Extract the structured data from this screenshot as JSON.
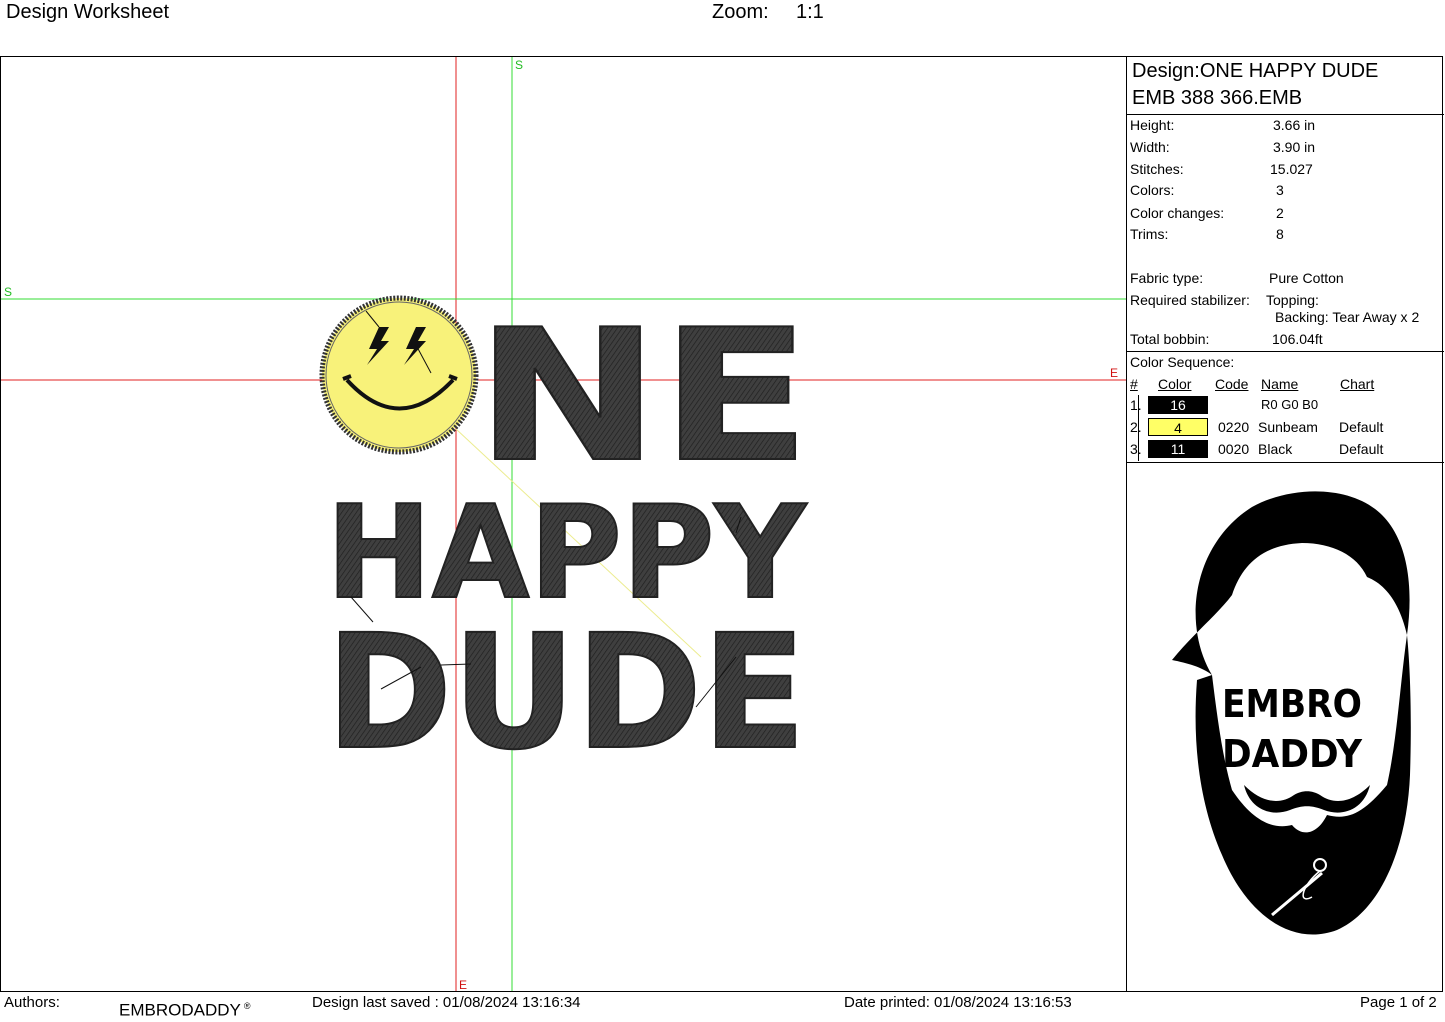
{
  "header": {
    "title": "Design Worksheet",
    "zoom_label": "Zoom:",
    "zoom_value": "1:1"
  },
  "canvas": {
    "marker_s": "S",
    "marker_e": "E",
    "design_text": {
      "line1": "NE",
      "line2": "HAPPY",
      "line3": "DUDE"
    },
    "colors": {
      "stitch_black": "#3f3f3f",
      "sunbeam": "#f8f27a",
      "guide_red": "#e02020",
      "guide_green": "#33dd33"
    }
  },
  "panel": {
    "design_name": "Design:ONE HAPPY DUDE",
    "file_name": "EMB 388 366.EMB",
    "stats": [
      {
        "label": "Height:",
        "value": "3.66 in"
      },
      {
        "label": "Width:",
        "value": "3.90 in"
      },
      {
        "label": "Stitches:",
        "value": "15.027"
      },
      {
        "label": "Colors:",
        "value": "3"
      },
      {
        "label": "Color changes:",
        "value": "2"
      },
      {
        "label": "Trims:",
        "value": "8"
      }
    ],
    "fabric_label": "Fabric type:",
    "fabric_value": "Pure Cotton",
    "stabilizer_label": "Required stabilizer:",
    "topping": "Topping:",
    "backing": "Backing: Tear Away x 2",
    "bobbin_label": "Total bobbin:",
    "bobbin_value": "106.04ft",
    "color_sequence_title": "Color Sequence:",
    "table_headers": {
      "num": "#",
      "color": "Color",
      "code": "Code",
      "name": "Name",
      "chart": "Chart"
    },
    "color_rows": [
      {
        "num": "1.",
        "color_num": "16",
        "swatch": "#000000",
        "text": "#ffffff",
        "code": "",
        "name": "R0 G0 B0",
        "chart": ""
      },
      {
        "num": "2.",
        "color_num": "4",
        "swatch": "#ffff66",
        "text": "#000000",
        "code": "0220",
        "name": "Sunbeam",
        "chart": "Default"
      },
      {
        "num": "3.",
        "color_num": "11",
        "swatch": "#000000",
        "text": "#ffffff",
        "code": "0020",
        "name": "Black",
        "chart": "Default"
      }
    ],
    "logo": {
      "line1": "EMBRO",
      "line2": "DADDY"
    }
  },
  "footer": {
    "authors_label": "Authors:",
    "brand": "EMBRODADDY",
    "brand_mark": "®",
    "saved": "Design last saved : 01/08/2024 13:16:34",
    "printed": "Date printed: 01/08/2024 13:16:53",
    "page": "Page 1 of 2"
  }
}
